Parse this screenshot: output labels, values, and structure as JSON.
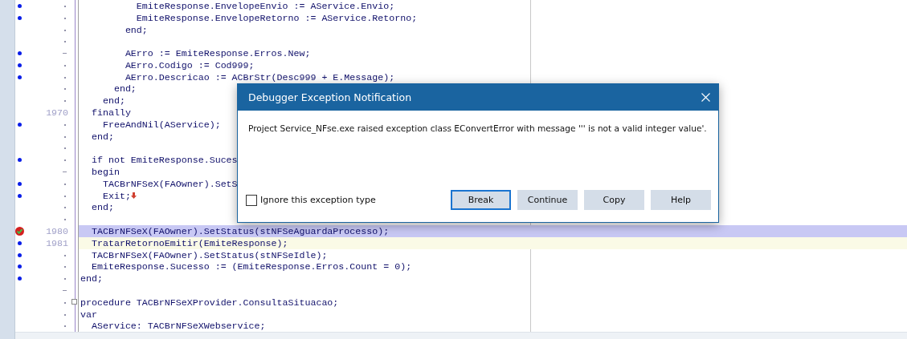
{
  "editor": {
    "lines": [
      {
        "bullet": true,
        "kind": "dot",
        "text": "          EmiteResponse.EnvelopeEnvio := AService.Envio;"
      },
      {
        "bullet": true,
        "kind": "dot",
        "text": "          EmiteResponse.EnvelopeRetorno := AService.Retorno;"
      },
      {
        "bullet": false,
        "kind": "dot",
        "text": "        end;"
      },
      {
        "bullet": false,
        "kind": "dot"
      },
      {
        "bullet": true,
        "kind": "dash",
        "text": "        AErro := EmiteResponse.Erros.New;"
      },
      {
        "bullet": true,
        "kind": "dot",
        "text": "        AErro.Codigo := Cod999;"
      },
      {
        "bullet": true,
        "kind": "dot",
        "text": "        AErro.Descricao := ACBrStr(Desc999 + E.Message);"
      },
      {
        "bullet": false,
        "kind": "dot",
        "text": "      end;"
      },
      {
        "bullet": false,
        "kind": "dot",
        "text": "    end;"
      },
      {
        "bullet": false,
        "kind": "numbered",
        "number": "1970",
        "text": "  finally"
      },
      {
        "bullet": true,
        "kind": "dot",
        "text": "    FreeAndNil(AService);"
      },
      {
        "bullet": false,
        "kind": "dot",
        "text": "  end;"
      },
      {
        "bullet": false,
        "kind": "dot"
      },
      {
        "bullet": true,
        "kind": "dot",
        "text": "  if not EmiteResponse.Suces"
      },
      {
        "bullet": false,
        "kind": "dash",
        "text": "  begin"
      },
      {
        "bullet": true,
        "kind": "dot",
        "text": "    TACBrNFSeX(FAOwner).SetS"
      },
      {
        "bullet": true,
        "kind": "dot",
        "text": "    Exit;",
        "arrow": true
      },
      {
        "bullet": false,
        "kind": "dot",
        "text": "  end;"
      },
      {
        "bullet": false,
        "kind": "dot"
      },
      {
        "bullet": false,
        "breakpoint": true,
        "kind": "numbered",
        "number": "1980",
        "execution_point": true,
        "text": "  TACBrNFSeX(FAOwner).SetStatus(stNFSeAguardaProcesso);"
      },
      {
        "bullet": true,
        "kind": "numbered",
        "number": "1981",
        "current_line": true,
        "text": "  TratarRetornoEmitir(EmiteResponse);"
      },
      {
        "bullet": true,
        "kind": "dot",
        "text": "  TACBrNFSeX(FAOwner).SetStatus(stNFSeIdle);"
      },
      {
        "bullet": true,
        "kind": "dot",
        "text": "  EmiteResponse.Sucesso := (EmiteResponse.Erros.Count = 0);"
      },
      {
        "bullet": true,
        "kind": "dot",
        "text": "end;"
      },
      {
        "bullet": false,
        "kind": "dash"
      },
      {
        "bullet": false,
        "kind": "dot",
        "fold": true,
        "text": "procedure TACBrNFSeXProvider.ConsultaSituacao;"
      },
      {
        "bullet": false,
        "kind": "dot",
        "text": "var"
      },
      {
        "bullet": false,
        "kind": "dot",
        "text": "  AService: TACBrNFSeXWebservice;"
      }
    ]
  },
  "dialog": {
    "title": "Debugger Exception Notification",
    "message": "Project Service_NFse.exe raised exception class EConvertError with message ''' is not a valid integer value'.",
    "checkbox": {
      "label": "Ignore this exception type",
      "checked": false
    },
    "buttons": [
      {
        "label": "Break",
        "selected": true
      },
      {
        "label": "Continue",
        "selected": false
      },
      {
        "label": "Copy",
        "selected": false
      },
      {
        "label": "Help",
        "selected": false
      }
    ]
  }
}
